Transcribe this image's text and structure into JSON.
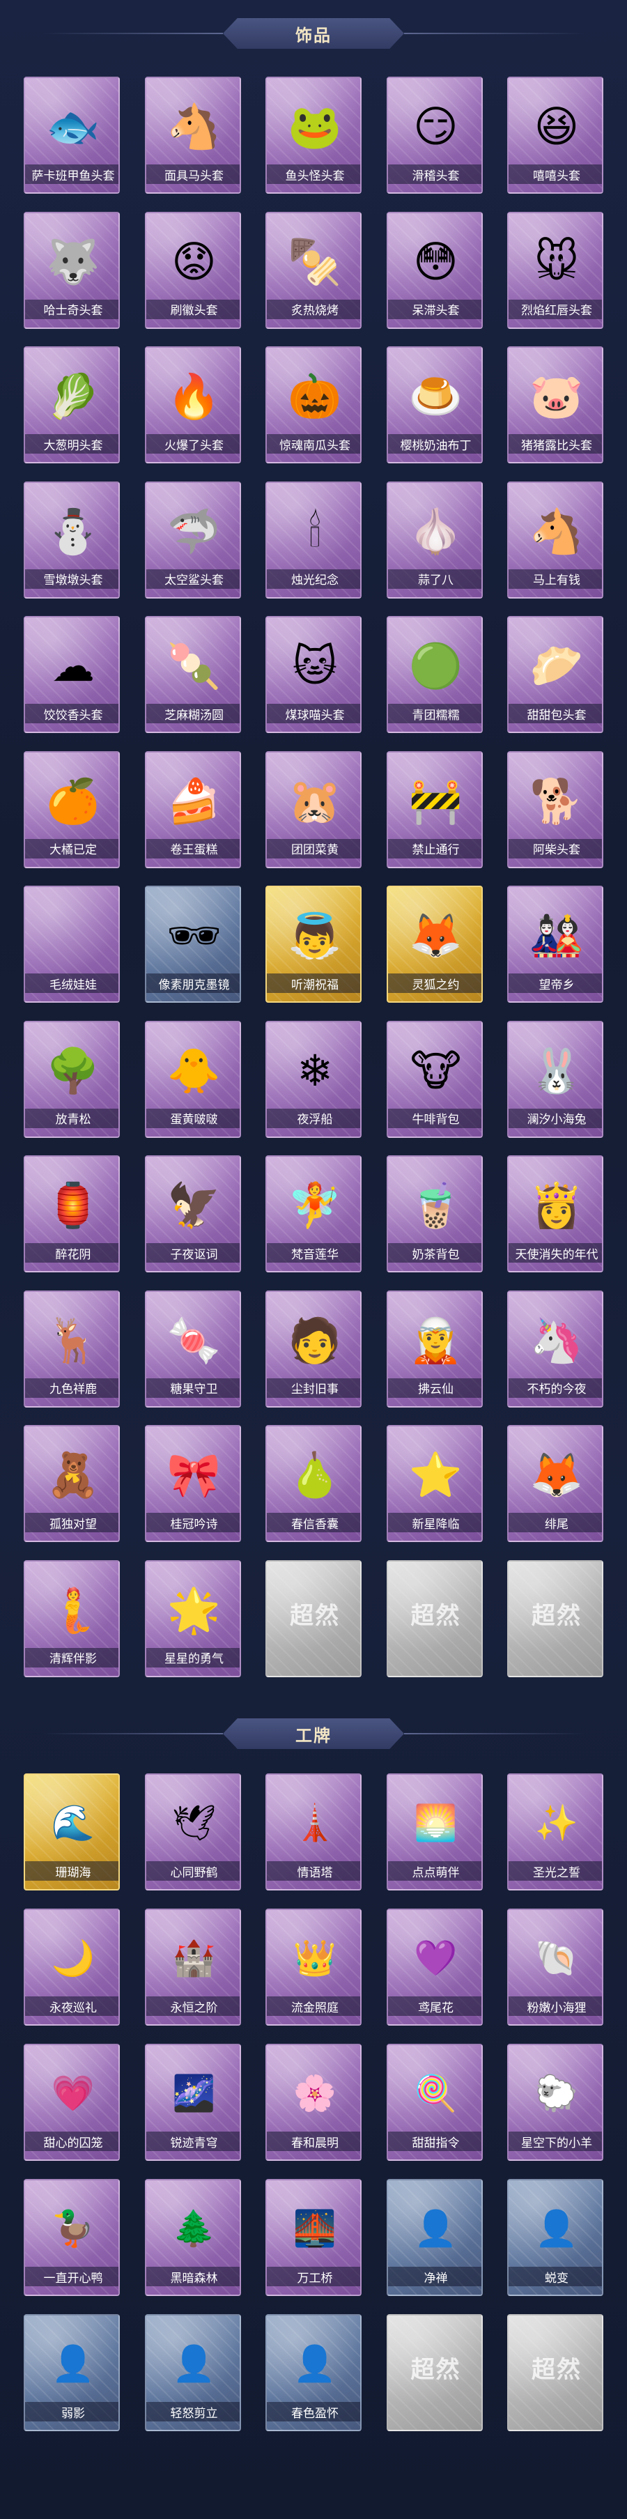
{
  "sections": [
    {
      "title": "饰品"
    },
    {
      "title": "工牌"
    }
  ],
  "accessories": [
    {
      "label": "萨卡班甲鱼头套",
      "icon": "🐟",
      "style": "purple"
    },
    {
      "label": "面具马头套",
      "icon": "🐴",
      "style": "purple"
    },
    {
      "label": "鱼头怪头套",
      "icon": "🐸",
      "style": "purple"
    },
    {
      "label": "滑稽头套",
      "icon": "😏",
      "style": "purple"
    },
    {
      "label": "嘻嘻头套",
      "icon": "😆",
      "style": "purple"
    },
    {
      "label": "哈士奇头套",
      "icon": "🐺",
      "style": "purple"
    },
    {
      "label": "刷徽头套",
      "icon": "😟",
      "style": "purple"
    },
    {
      "label": "炙热烧烤",
      "icon": "🍢",
      "style": "purple"
    },
    {
      "label": "呆滞头套",
      "icon": "😳",
      "style": "purple"
    },
    {
      "label": "烈焰红唇头套",
      "icon": "🐭",
      "style": "purple"
    },
    {
      "label": "大葱明头套",
      "icon": "🥬",
      "style": "purple"
    },
    {
      "label": "火爆了头套",
      "icon": "🔥",
      "style": "purple"
    },
    {
      "label": "惊魂南瓜头套",
      "icon": "🎃",
      "style": "purple"
    },
    {
      "label": "樱桃奶油布丁",
      "icon": "🍮",
      "style": "purple"
    },
    {
      "label": "猪猪露比头套",
      "icon": "🐷",
      "style": "purple"
    },
    {
      "label": "雪墩墩头套",
      "icon": "⛄",
      "style": "purple"
    },
    {
      "label": "太空鲨头套",
      "icon": "🦈",
      "style": "purple"
    },
    {
      "label": "烛光纪念",
      "icon": "🕯",
      "style": "purple"
    },
    {
      "label": "蒜了八",
      "icon": "🧄",
      "style": "purple"
    },
    {
      "label": "马上有钱",
      "icon": "🐴",
      "style": "purple"
    },
    {
      "label": "饺饺香头套",
      "icon": "☁",
      "style": "purple"
    },
    {
      "label": "芝麻糊汤圆",
      "icon": "🍡",
      "style": "purple"
    },
    {
      "label": "煤球喵头套",
      "icon": "🐱",
      "style": "purple"
    },
    {
      "label": "青团糯糯",
      "icon": "🟢",
      "style": "purple"
    },
    {
      "label": "甜甜包头套",
      "icon": "🥟",
      "style": "purple"
    },
    {
      "label": "大橘已定",
      "icon": "🍊",
      "style": "purple"
    },
    {
      "label": "卷王蛋糕",
      "icon": "🍰",
      "style": "purple"
    },
    {
      "label": "团团菜黄",
      "icon": "🐹",
      "style": "purple"
    },
    {
      "label": "禁止通行",
      "icon": "🚧",
      "style": "purple"
    },
    {
      "label": "阿柴头套",
      "icon": "🐕",
      "style": "purple"
    },
    {
      "label": "毛绒娃娃",
      "icon": "",
      "style": "purple"
    },
    {
      "label": "像素朋克墨镜",
      "icon": "🕶",
      "style": "blue"
    },
    {
      "label": "听潮祝福",
      "icon": "👼",
      "style": "gold"
    },
    {
      "label": "灵狐之约",
      "icon": "🦊",
      "style": "gold"
    },
    {
      "label": "望帝乡",
      "icon": "🎎",
      "style": "purple"
    },
    {
      "label": "放青松",
      "icon": "🌳",
      "style": "purple"
    },
    {
      "label": "蛋黄啵啵",
      "icon": "🐥",
      "style": "purple"
    },
    {
      "label": "夜浮船",
      "icon": "❄",
      "style": "purple"
    },
    {
      "label": "牛啡背包",
      "icon": "🐮",
      "style": "purple"
    },
    {
      "label": "澜汐小海兔",
      "icon": "🐰",
      "style": "purple"
    },
    {
      "label": "醉花阴",
      "icon": "🏮",
      "style": "purple"
    },
    {
      "label": "子夜讴词",
      "icon": "🦅",
      "style": "purple"
    },
    {
      "label": "梵音莲华",
      "icon": "🧚",
      "style": "purple"
    },
    {
      "label": "奶茶背包",
      "icon": "🧋",
      "style": "purple"
    },
    {
      "label": "天使消失的年代",
      "icon": "👸",
      "style": "purple"
    },
    {
      "label": "九色祥鹿",
      "icon": "🦌",
      "style": "purple"
    },
    {
      "label": "糖果守卫",
      "icon": "🍬",
      "style": "purple"
    },
    {
      "label": "尘封旧事",
      "icon": "🧑",
      "style": "purple"
    },
    {
      "label": "拂云仙",
      "icon": "🧝",
      "style": "purple"
    },
    {
      "label": "不朽的今夜",
      "icon": "🦄",
      "style": "purple"
    },
    {
      "label": "孤独对望",
      "icon": "🧸",
      "style": "purple"
    },
    {
      "label": "桂冠吟诗",
      "icon": "🎀",
      "style": "purple"
    },
    {
      "label": "春信香囊",
      "icon": "🍐",
      "style": "purple"
    },
    {
      "label": "新星降临",
      "icon": "⭐",
      "style": "purple"
    },
    {
      "label": "绯尾",
      "icon": "🦊",
      "style": "purple"
    },
    {
      "label": "清辉伴影",
      "icon": "🧜",
      "style": "purple"
    },
    {
      "label": "星星的勇气",
      "icon": "🌟",
      "style": "purple"
    },
    {
      "label": "",
      "icon": "",
      "style": "gray",
      "placeholder": true
    },
    {
      "label": "",
      "icon": "",
      "style": "gray",
      "placeholder": true
    },
    {
      "label": "",
      "icon": "",
      "style": "gray",
      "placeholder": true
    }
  ],
  "badges": [
    {
      "label": "珊瑚海",
      "icon": "🌊",
      "style": "gold"
    },
    {
      "label": "心同野鹤",
      "icon": "🕊",
      "style": "purple"
    },
    {
      "label": "情语塔",
      "icon": "🗼",
      "style": "purple"
    },
    {
      "label": "点点萌伴",
      "icon": "🌅",
      "style": "purple"
    },
    {
      "label": "圣光之誓",
      "icon": "✨",
      "style": "purple"
    },
    {
      "label": "永夜巡礼",
      "icon": "🌙",
      "style": "purple"
    },
    {
      "label": "永恒之阶",
      "icon": "🏰",
      "style": "purple"
    },
    {
      "label": "流金照庭",
      "icon": "👑",
      "style": "purple"
    },
    {
      "label": "鸢尾花",
      "icon": "💜",
      "style": "purple"
    },
    {
      "label": "粉嫩小海狸",
      "icon": "🐚",
      "style": "purple"
    },
    {
      "label": "甜心的囚笼",
      "icon": "💗",
      "style": "purple"
    },
    {
      "label": "锐迹青穹",
      "icon": "🌌",
      "style": "purple"
    },
    {
      "label": "春和晨明",
      "icon": "🌸",
      "style": "purple"
    },
    {
      "label": "甜甜指令",
      "icon": "🍭",
      "style": "purple"
    },
    {
      "label": "星空下的小羊",
      "icon": "🐑",
      "style": "purple"
    },
    {
      "label": "一直开心鸭",
      "icon": "🦆",
      "style": "purple"
    },
    {
      "label": "黑暗森林",
      "icon": "🌲",
      "style": "purple"
    },
    {
      "label": "万工桥",
      "icon": "🌉",
      "style": "purple"
    },
    {
      "label": "净禅",
      "icon": "👤",
      "style": "blue"
    },
    {
      "label": "蜕变",
      "icon": "👤",
      "style": "blue"
    },
    {
      "label": "弱影",
      "icon": "👤",
      "style": "blue"
    },
    {
      "label": "轻怒剪立",
      "icon": "👤",
      "style": "blue"
    },
    {
      "label": "春色盈怀",
      "icon": "👤",
      "style": "blue"
    },
    {
      "label": "",
      "icon": "",
      "style": "gray",
      "placeholder": true
    },
    {
      "label": "",
      "icon": "",
      "style": "gray",
      "placeholder": true
    }
  ],
  "placeholder_logo": "超然"
}
